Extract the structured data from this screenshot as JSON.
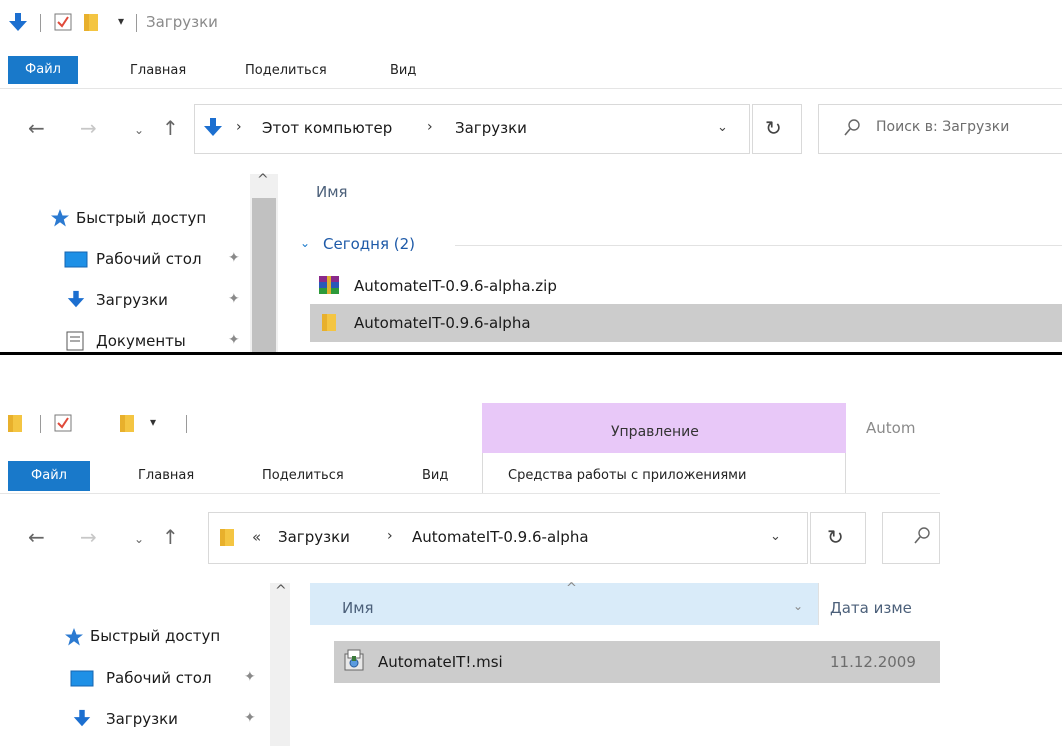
{
  "top": {
    "title": "Загрузки",
    "tabs": {
      "file": "Файл",
      "home": "Главная",
      "share": "Поделиться",
      "view": "Вид"
    },
    "path": {
      "computer": "Этот компьютер",
      "folder": "Загрузки"
    },
    "search_placeholder": "Поиск в: Загрузки",
    "sidebar": {
      "quick_access": "Быстрый доступ",
      "desktop": "Рабочий сто⁠л",
      "downloads": "Загрузки",
      "documents": "Документы"
    },
    "column_name": "Имя",
    "group": "Сегодня (2)",
    "files": [
      "AutomateIT-0.9.6-alpha.zip",
      "AutomateIT-0.9.6-alpha"
    ]
  },
  "bottom": {
    "title": "Autom",
    "context_tab_header": "Управление",
    "tabs": {
      "file": "Файл",
      "home": "Главная",
      "share": "Поделиться",
      "view": "Вид",
      "app_tools": "Средства работы с приложениями"
    },
    "path": {
      "overflow": "«",
      "parent": "Загрузки",
      "folder": "AutomateIT-0.9.6-alpha"
    },
    "sidebar": {
      "quick_access": "Быстрый доступ",
      "desktop": "Рабочий сто⁠л",
      "downloads": "Загрузки"
    },
    "columns": {
      "name": "Имя",
      "date": "Дата изме"
    },
    "files": [
      {
        "name": "AutomateIT!.msi",
        "date": "11.12.2009"
      }
    ]
  },
  "colors": {
    "file_tab": "#1979ca",
    "context_tab": "#e8c8f8",
    "selection": "#cccccc",
    "column_header_hover": "#d9ebf9",
    "link_blue": "#1979ca",
    "divider": "#000000"
  }
}
